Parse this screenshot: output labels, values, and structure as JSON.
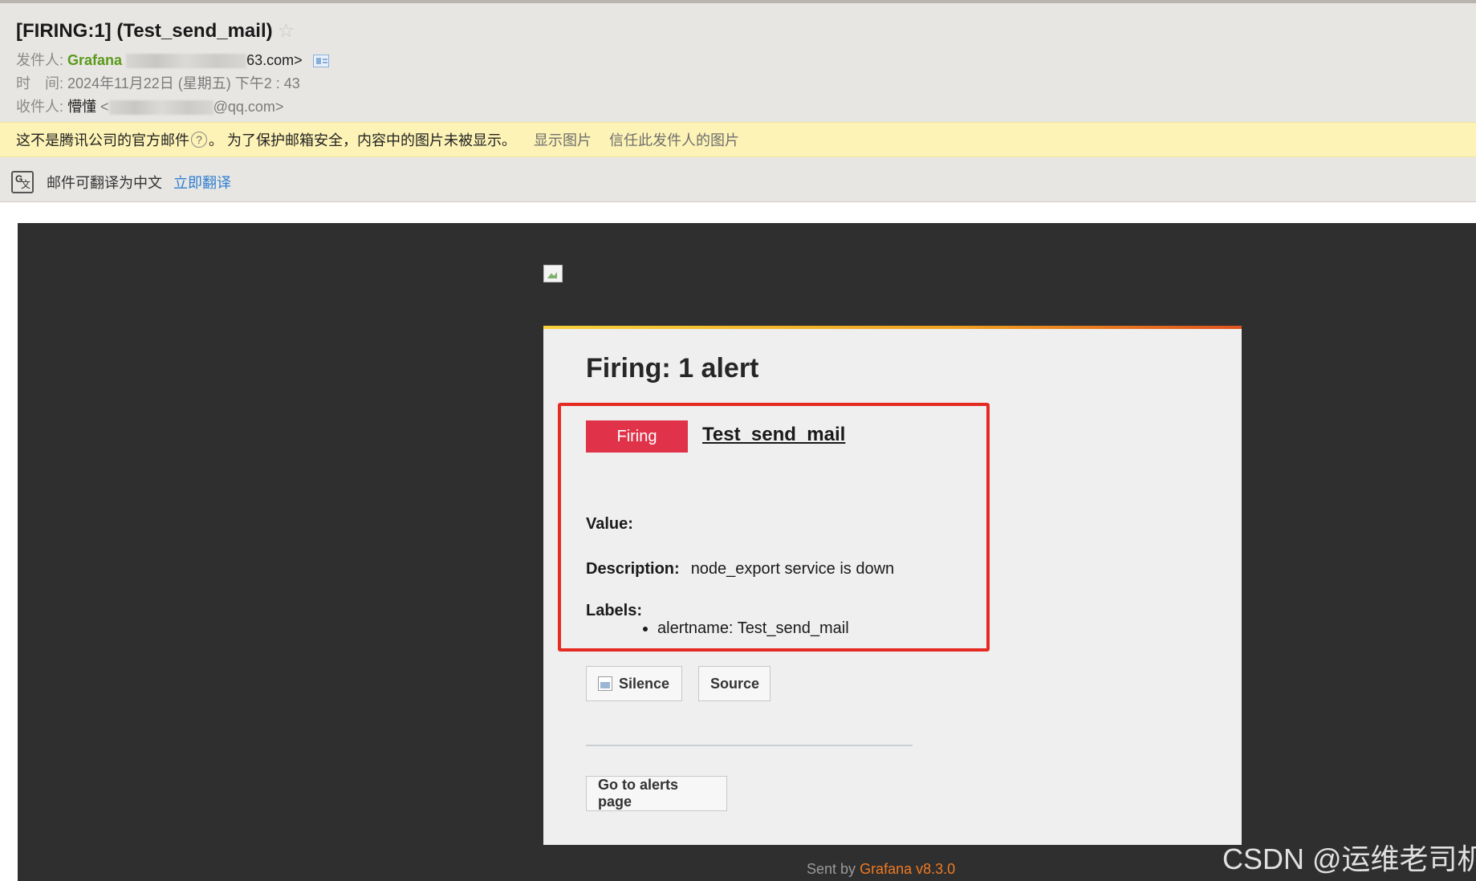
{
  "mail": {
    "subject": "[FIRING:1] (Test_send_mail)",
    "from_label": "发件人:",
    "from_name": "Grafana",
    "from_addr_tail": "63.com>",
    "time_label": "时　间:",
    "time_value": "2024年11月22日 (星期五) 下午2 : 43",
    "to_label": "收件人:",
    "to_name": "懵懂",
    "to_addr_head": "<",
    "to_addr_tail": "@qq.com>"
  },
  "warning": {
    "text_before": "这不是腾讯公司的官方邮件",
    "help_glyph": "?",
    "text_after": "。 为了保护邮箱安全，内容中的图片未被显示。",
    "show_images": "显示图片",
    "trust_sender": "信任此发件人的图片"
  },
  "translate": {
    "icon_glyph": "文",
    "text": "邮件可翻译为中文",
    "link": "立即翻译"
  },
  "alert": {
    "heading": "Firing: 1 alert",
    "status": "Firing",
    "name": "Test_send_mail",
    "value_label": "Value:",
    "description_label": "Description:",
    "description_value": "node_export service is down",
    "labels_label": "Labels:",
    "labels": [
      "alertname: Test_send_mail"
    ],
    "silence_button": "Silence",
    "source_button": "Source",
    "alerts_page_button": "Go to alerts page"
  },
  "footer": {
    "sent_by": "Sent by",
    "product": "Grafana v8.3.0"
  },
  "watermark": "CSDN @运维老司机",
  "colors": {
    "firing": "#e0334a",
    "highlight_box": "#e52a22",
    "grafana_orange": "#f07b22",
    "sender_green": "#5a9a1a"
  }
}
